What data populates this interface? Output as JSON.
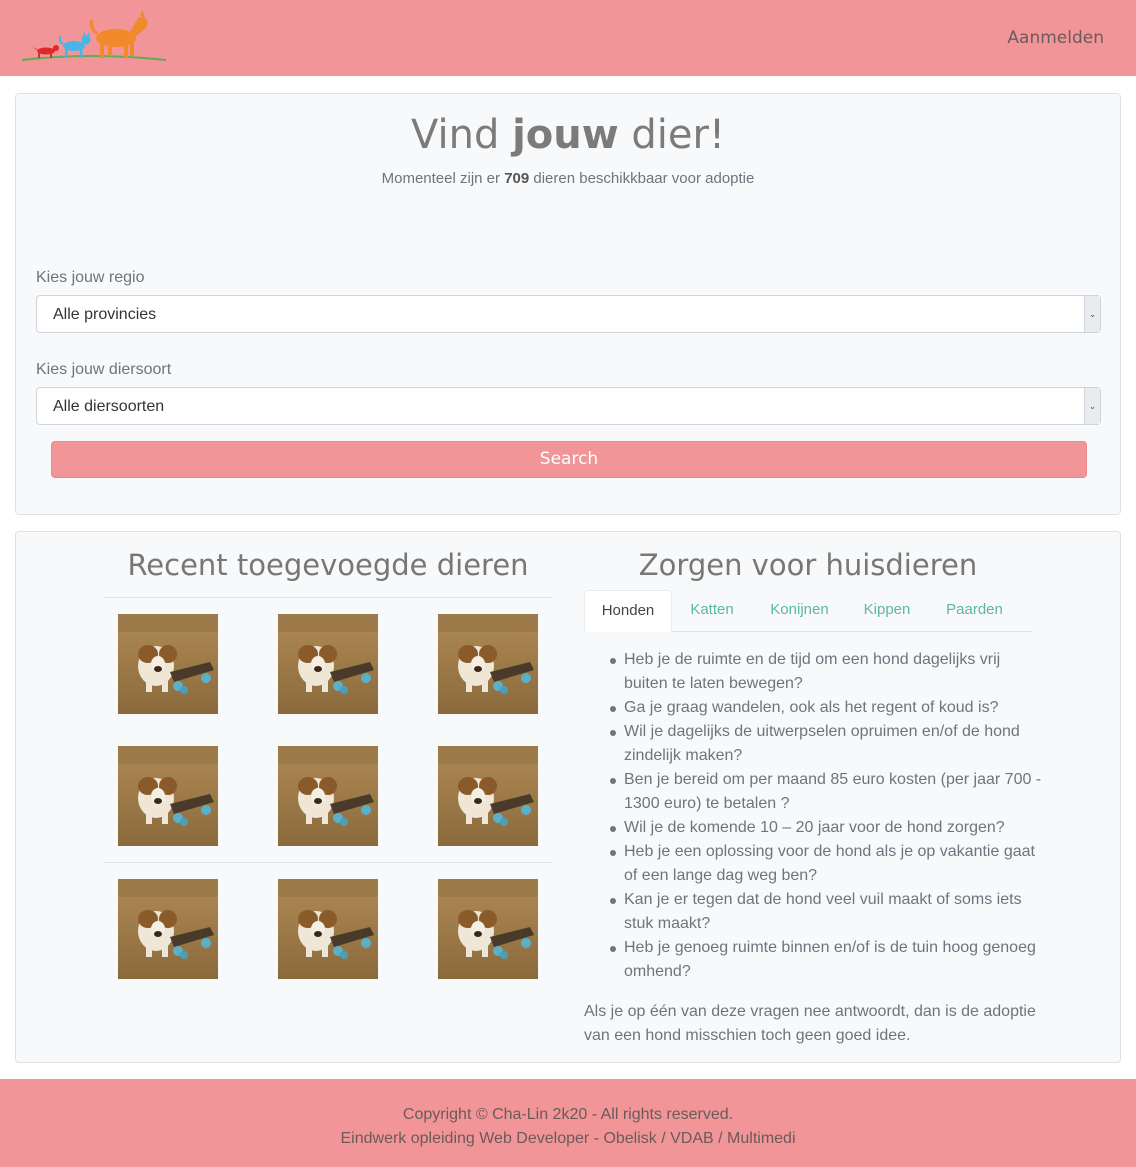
{
  "nav": {
    "login_label": "Aanmelden",
    "logo_icon": "animals-logo-icon"
  },
  "hero": {
    "title_prefix": "Vind ",
    "title_bold": "jouw",
    "title_suffix": " dier!",
    "subtitle_prefix": "Momenteel zijn er ",
    "count": "709",
    "subtitle_suffix": " dieren beschikkbaar voor adoptie"
  },
  "search": {
    "region_label": "Kies jouw regio",
    "region_value": "Alle provincies",
    "species_label": "Kies jouw diersoort",
    "species_value": "Alle diersoorten",
    "button_label": "Search"
  },
  "recent": {
    "title": "Recent toegevoegde dieren",
    "image_icon": "puppy-skateboard-photo"
  },
  "care": {
    "title": "Zorgen voor huisdieren",
    "tabs": [
      {
        "label": "Honden"
      },
      {
        "label": "Katten"
      },
      {
        "label": "Konijnen"
      },
      {
        "label": "Kippen"
      },
      {
        "label": "Paarden"
      }
    ],
    "questions": [
      "Heb je de ruimte en de tijd om een hond dagelijks vrij buiten te laten bewegen?",
      "Ga je graag wandelen, ook als het regent of koud is?",
      "Wil je dagelijks de uitwerpselen opruimen en/of de hond zindelijk maken?",
      "Ben je bereid om per maand 85 euro kosten (per jaar 700 - 1300 euro) te betalen ?",
      "Wil je de komende 10 – 20 jaar voor de hond zorgen?",
      "Heb je een oplossing voor de hond als je op vakantie gaat of een lange dag weg ben?",
      "Kan je er tegen dat de hond veel vuil maakt of soms iets stuk maakt?",
      "Heb je genoeg ruimte binnen en/of is de tuin hoog genoeg omhend?"
    ],
    "note": "Als je op één van deze vragen nee antwoordt, dan is de adoptie van een hond misschien toch geen goed idee."
  },
  "footer": {
    "copyright": "Copyright © Cha-Lin 2k20 - All rights reserved.",
    "credits": "Eindwerk opleiding Web Developer - Obelisk / VDAB / Multimedi"
  },
  "colors": {
    "brand": "#f29598",
    "tab_link": "#5cb8a0"
  }
}
